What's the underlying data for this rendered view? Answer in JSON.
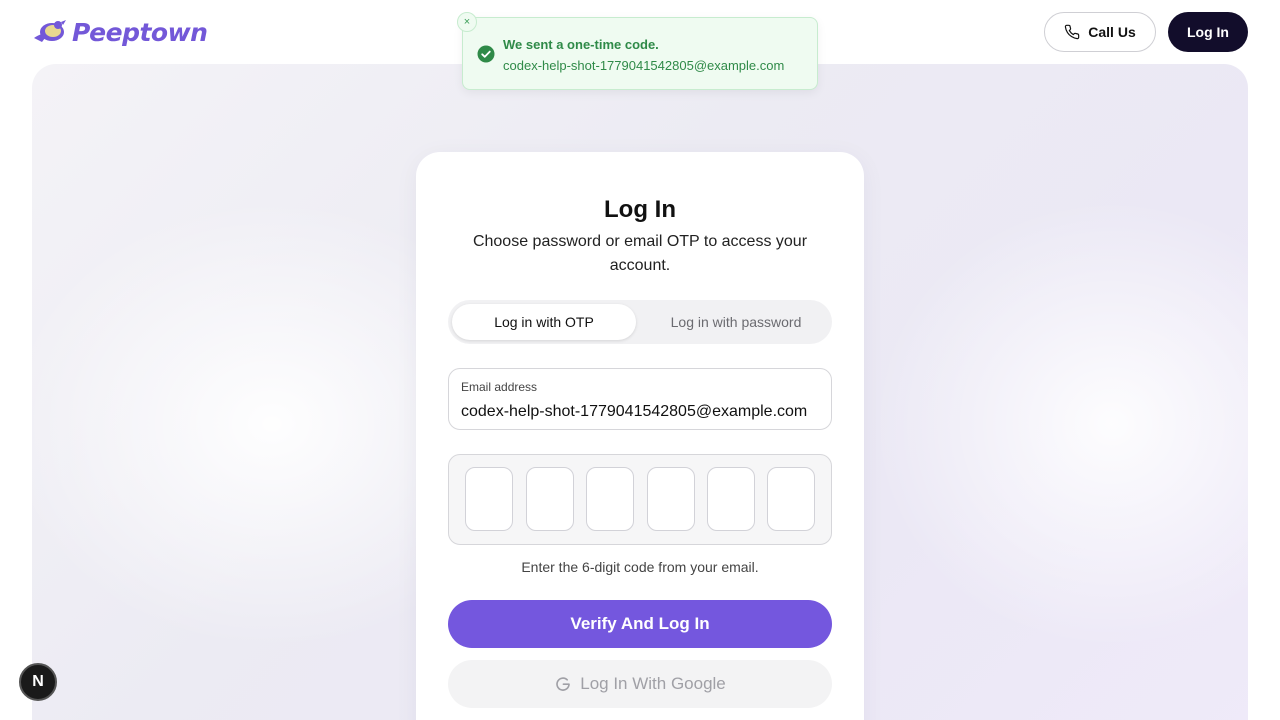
{
  "header": {
    "brand": "Peeptown",
    "call_label": "Call Us",
    "login_label": "Log In"
  },
  "toast": {
    "title": "We sent a one-time code.",
    "description": "codex-help-shot-1779041542805@example.com",
    "close_glyph": "×"
  },
  "card": {
    "title": "Log In",
    "subtitle": "Choose password or email OTP to access your account.",
    "tabs": [
      {
        "label": "Log in with OTP",
        "active": true
      },
      {
        "label": "Log in with password",
        "active": false
      }
    ],
    "email": {
      "label": "Email address",
      "value": "codex-help-shot-1779041542805@example.com"
    },
    "otp_cells": [
      "",
      "",
      "",
      "",
      "",
      ""
    ],
    "otp_help": "Enter the 6-digit code from your email.",
    "verify_label": "Verify And Log In",
    "google_label": "Log In With Google"
  },
  "dev_badge": {
    "glyph": "N"
  },
  "icons": {
    "logo": "bird-logo-icon",
    "call": "phone-icon",
    "toast_status": "check-circle-icon",
    "google": "google-g-icon"
  },
  "colors": {
    "brand": "#7358d8",
    "primary_button": "#7457de",
    "dark_button": "#120d2b",
    "toast_success": "#2f8a48"
  }
}
